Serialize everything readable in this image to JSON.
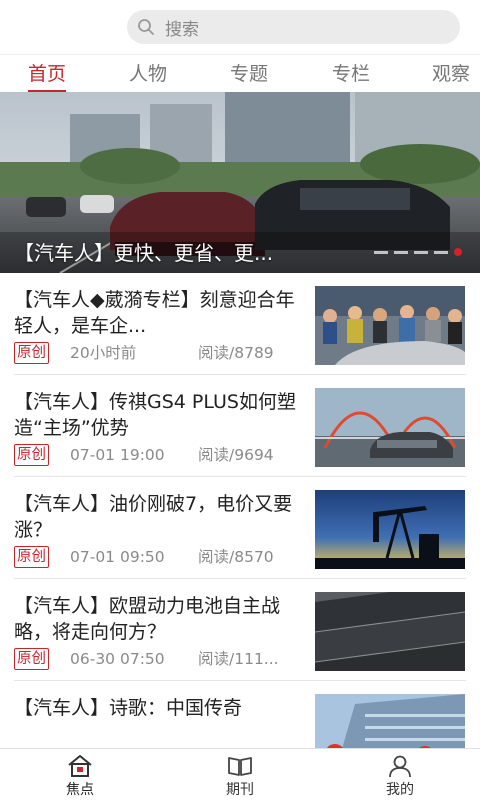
{
  "search": {
    "placeholder": "搜索"
  },
  "tabs": [
    {
      "label": "首页",
      "active": true
    },
    {
      "label": "人物"
    },
    {
      "label": "专题"
    },
    {
      "label": "专栏"
    },
    {
      "label": "观察"
    }
  ],
  "banner": {
    "caption": "【汽车人】更快、更省、更..."
  },
  "articles": [
    {
      "title": "【汽车人◆葳漪专栏】刻意迎合年轻人，是车企...",
      "tag": "原创",
      "time": "20小时前",
      "reads": "阅读/8789",
      "thumb": "crowd-car-show"
    },
    {
      "title": "【汽车人】传祺GS4 PLUS如何塑造“主场”优势",
      "tag": "原创",
      "time": "07-01 19:00",
      "reads": "阅读/9694",
      "thumb": "suv-bridge"
    },
    {
      "title": "【汽车人】油价刚破7，电价又要涨？",
      "tag": "原创",
      "time": "07-01 09:50",
      "reads": "阅读/8570",
      "thumb": "oil-pump-sunset"
    },
    {
      "title": "【汽车人】欧盟动力电池自主战略，将走向何方？",
      "tag": "原创",
      "time": "06-30 07:50",
      "reads": "阅读/111...",
      "thumb": "battery-modules"
    },
    {
      "title": "【汽车人】诗歌：中国传奇",
      "tag": "",
      "time": "",
      "reads": "",
      "thumb": "building-flowers"
    }
  ],
  "bottom_nav": [
    {
      "label": "焦点",
      "icon": "home-icon",
      "active": true
    },
    {
      "label": "期刊",
      "icon": "book-icon"
    },
    {
      "label": "我的",
      "icon": "person-icon"
    }
  ],
  "colors": {
    "accent": "#c6262c",
    "tab_inactive": "#777777"
  }
}
